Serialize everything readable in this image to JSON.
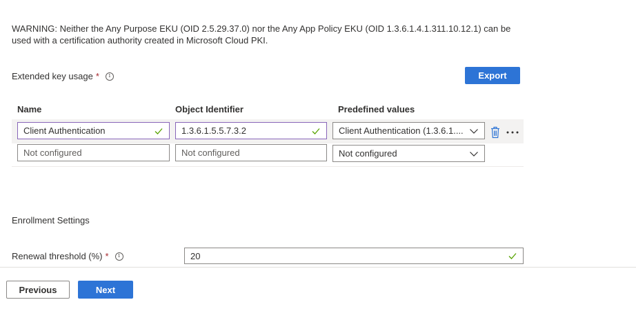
{
  "warning": "WARNING: Neither the Any Purpose EKU (OID 2.5.29.37.0) nor the Any App Policy EKU (OID 1.3.6.1.4.1.311.10.12.1) can be used with a certification authority created in Microsoft Cloud PKI.",
  "eku": {
    "label": "Extended key usage",
    "required": "*",
    "info": "i",
    "export_label": "Export",
    "columns": {
      "name": "Name",
      "oid": "Object Identifier",
      "predefined": "Predefined values"
    },
    "rows": [
      {
        "name": "Client Authentication",
        "oid": "1.3.6.1.5.5.7.3.2",
        "predefined": "Client Authentication (1.3.6.1...."
      },
      {
        "name_placeholder": "Not configured",
        "oid_placeholder": "Not configured",
        "predefined": "Not configured"
      }
    ]
  },
  "enrollment": {
    "title": "Enrollment Settings",
    "renewal_label": "Renewal threshold (%)",
    "required": "*",
    "info": "i",
    "renewal_value": "20"
  },
  "footer": {
    "previous_label": "Previous",
    "next_label": "Next"
  },
  "colors": {
    "primary": "#2d74d6",
    "valid_border": "#8764b8",
    "check": "#57a300",
    "required": "#a4262c",
    "delete_icon": "#2d74d6"
  }
}
